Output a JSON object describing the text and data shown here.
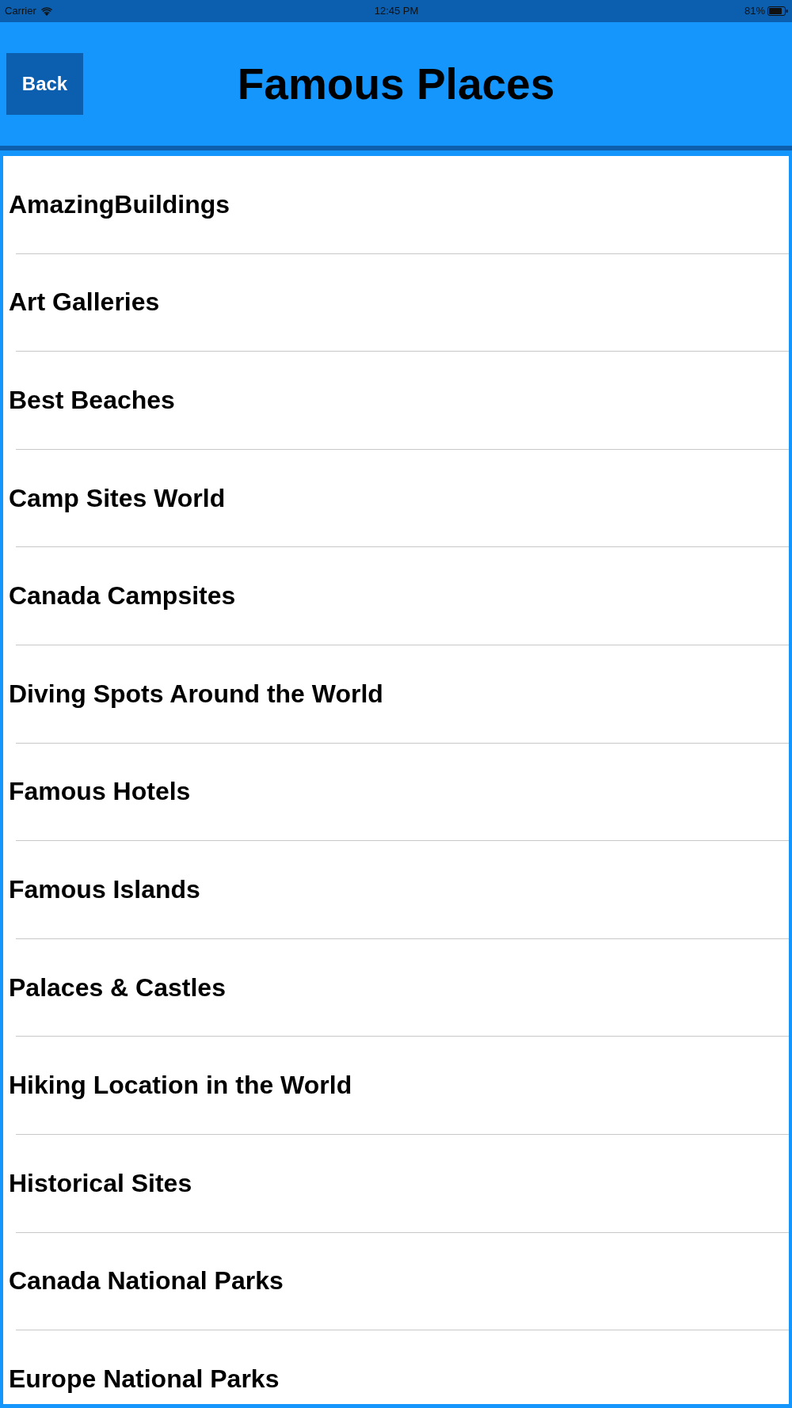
{
  "status_bar": {
    "carrier": "Carrier",
    "time": "12:45 PM",
    "battery": "81%"
  },
  "header": {
    "back_button": "Back",
    "title": "Famous Places"
  },
  "list": {
    "items": [
      "AmazingBuildings",
      "Art Galleries",
      "Best Beaches",
      "Camp Sites World",
      "Canada Campsites",
      "Diving Spots Around the World",
      "Famous Hotels",
      "Famous Islands",
      "Palaces & Castles",
      "Hiking Location in the World",
      "Historical Sites",
      "Canada National Parks",
      "Europe National Parks"
    ]
  }
}
